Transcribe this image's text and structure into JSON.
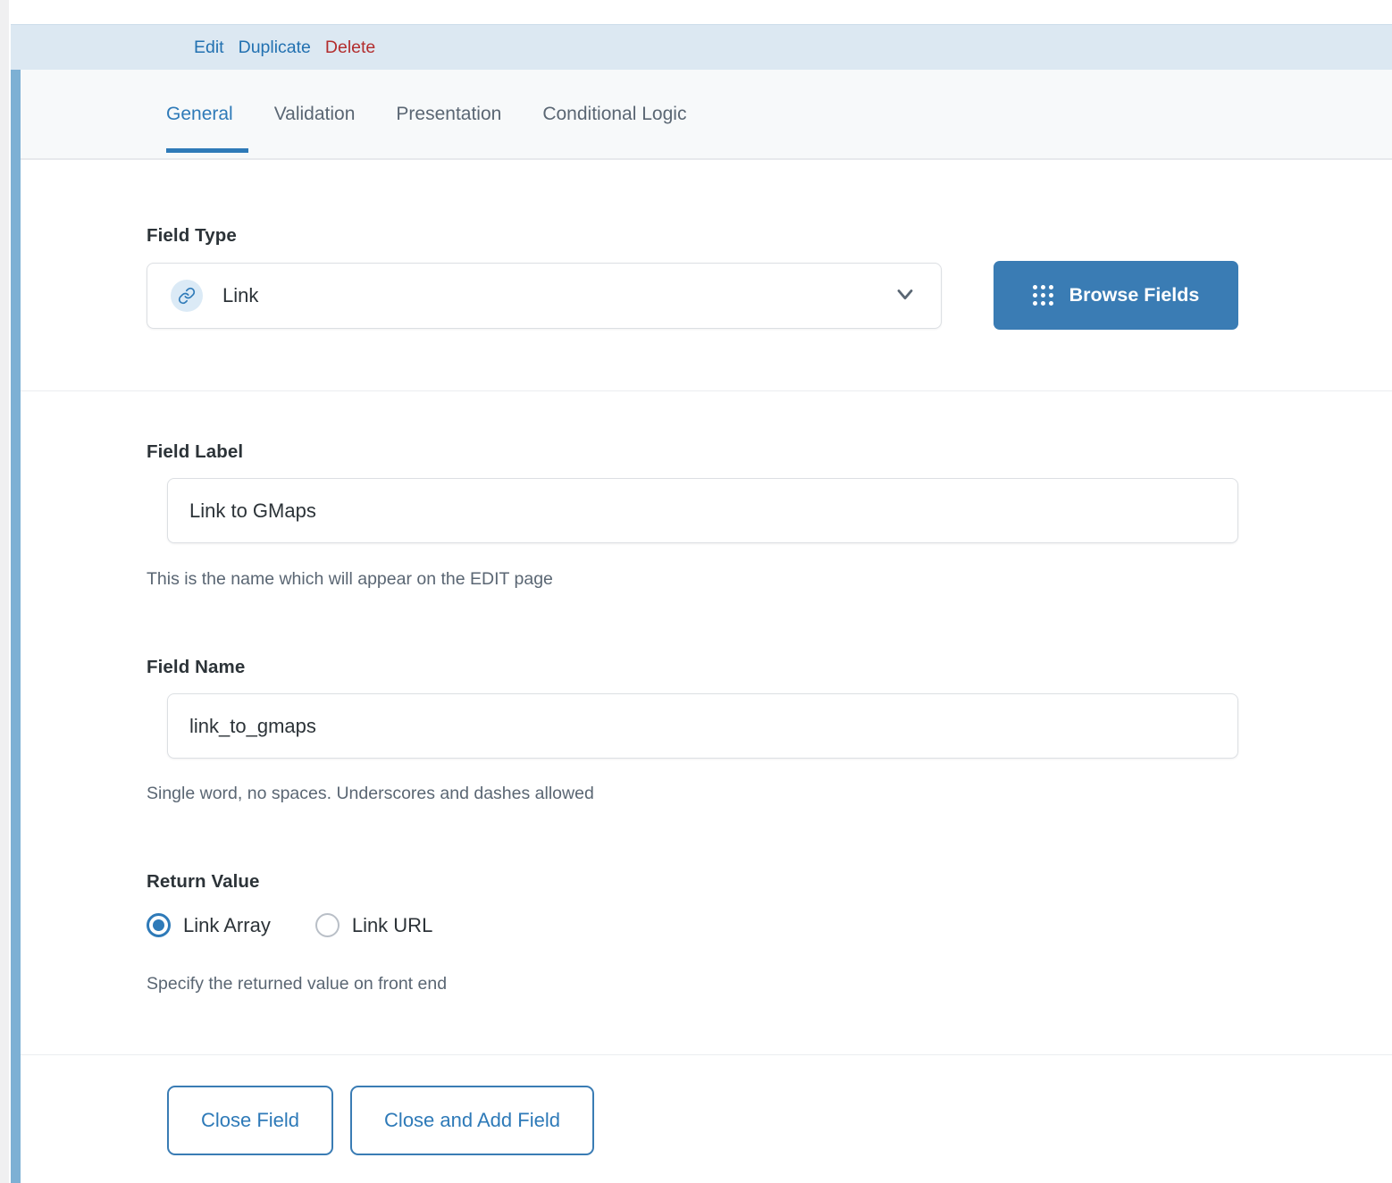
{
  "header": {
    "actions": [
      {
        "label": "Edit",
        "kind": "link",
        "name": "edit-link"
      },
      {
        "label": "Duplicate",
        "kind": "link",
        "name": "duplicate-link"
      },
      {
        "label": "Delete",
        "kind": "danger",
        "name": "delete-link"
      }
    ]
  },
  "tabs": [
    {
      "label": "General",
      "active": true
    },
    {
      "label": "Validation",
      "active": false
    },
    {
      "label": "Presentation",
      "active": false
    },
    {
      "label": "Conditional Logic",
      "active": false
    }
  ],
  "field_type": {
    "label": "Field Type",
    "selected": "Link",
    "icon": "link-icon",
    "chevron": "chevron-down-icon",
    "browse_button": "Browse Fields",
    "browse_icon": "grid-dots-icon"
  },
  "field_label": {
    "label": "Field Label",
    "value": "Link to GMaps",
    "placeholder": "",
    "hint": "This is the name which will appear on the EDIT page"
  },
  "field_name": {
    "label": "Field Name",
    "value": "link_to_gmaps",
    "placeholder": "",
    "hint": "Single word, no spaces. Underscores and dashes allowed"
  },
  "return_value": {
    "label": "Return Value",
    "options": [
      {
        "label": "Link Array",
        "checked": true
      },
      {
        "label": "Link URL",
        "checked": false
      }
    ],
    "hint": "Specify the returned value on front end"
  },
  "footer": {
    "close_field": "Close Field",
    "close_and_add_field": "Close and Add Field"
  },
  "colors": {
    "accent_blue": "#2e7ab8",
    "button_blue": "#3a7cb4",
    "link_blue": "#2271b1",
    "danger_red": "#b32d2e",
    "header_band": "#dce8f2",
    "active_bar": "#7db0d4",
    "tab_strip_bg": "#f7f9fa",
    "text_dark": "#2c3338",
    "text_muted": "#5a6673"
  }
}
